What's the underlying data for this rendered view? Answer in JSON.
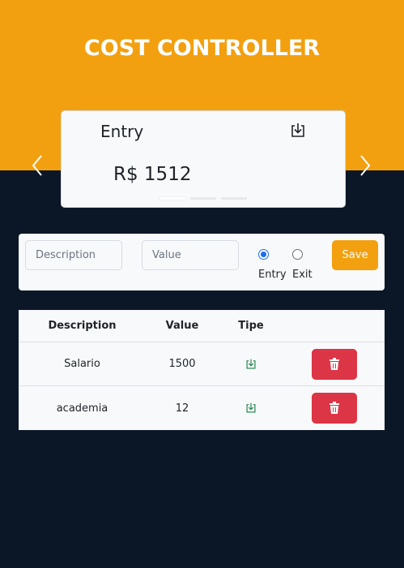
{
  "header": {
    "title": "COST CONTROLLER",
    "background_color": "#f2a010"
  },
  "carousel": {
    "slide": {
      "label": "Entry",
      "amount": "R$ 1512",
      "icon": "download-box-icon"
    },
    "indicators": 3,
    "active_indicator": 1
  },
  "form": {
    "description_placeholder": "Description",
    "value_placeholder": "Value",
    "radio_entry_label": "Entry",
    "radio_exit_label": "Exit",
    "selected_type": "Entry",
    "save_label": "Save"
  },
  "table": {
    "columns": [
      "Description",
      "Value",
      "Tipe",
      ""
    ],
    "rows": [
      {
        "description": "Salario",
        "value": "1500",
        "type_icon": "download-box-icon"
      },
      {
        "description": "academia",
        "value": "12",
        "type_icon": "download-box-icon"
      }
    ]
  },
  "colors": {
    "page_bg": "#0b1727",
    "accent": "#f2a010",
    "danger": "#dc3545",
    "entry_icon": "#2e8b57"
  }
}
